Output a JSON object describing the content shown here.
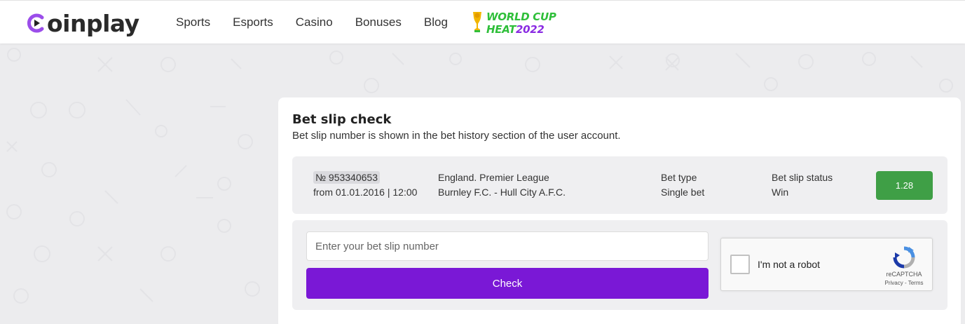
{
  "header": {
    "logo_text": "oinplay",
    "nav": [
      "Sports",
      "Esports",
      "Casino",
      "Bonuses",
      "Blog"
    ],
    "promo": {
      "line1": "WORLD CUP",
      "line2_a": "HEAT",
      "line2_b": "2022"
    }
  },
  "card": {
    "title": "Bet slip check",
    "subtitle": "Bet slip number is shown in the bet history section of the user account.",
    "slip": {
      "number": "№ 953340653",
      "date": "from 01.01.2016 | 12:00",
      "league": "England. Premier League",
      "match": "Burnley F.C. - Hull City A.F.C.",
      "bet_type_label": "Bet type",
      "bet_type": "Single bet",
      "status_label": "Bet slip status",
      "status": "Win",
      "odds": "1.28"
    },
    "form": {
      "placeholder": "Enter your bet slip number",
      "button": "Check"
    },
    "captcha": {
      "label": "I'm not a robot",
      "brand": "reCAPTCHA",
      "links": "Privacy - Terms"
    }
  },
  "colors": {
    "accent": "#7a18d6",
    "win": "#3f9f46",
    "logo_purple": "#9b4dea"
  }
}
